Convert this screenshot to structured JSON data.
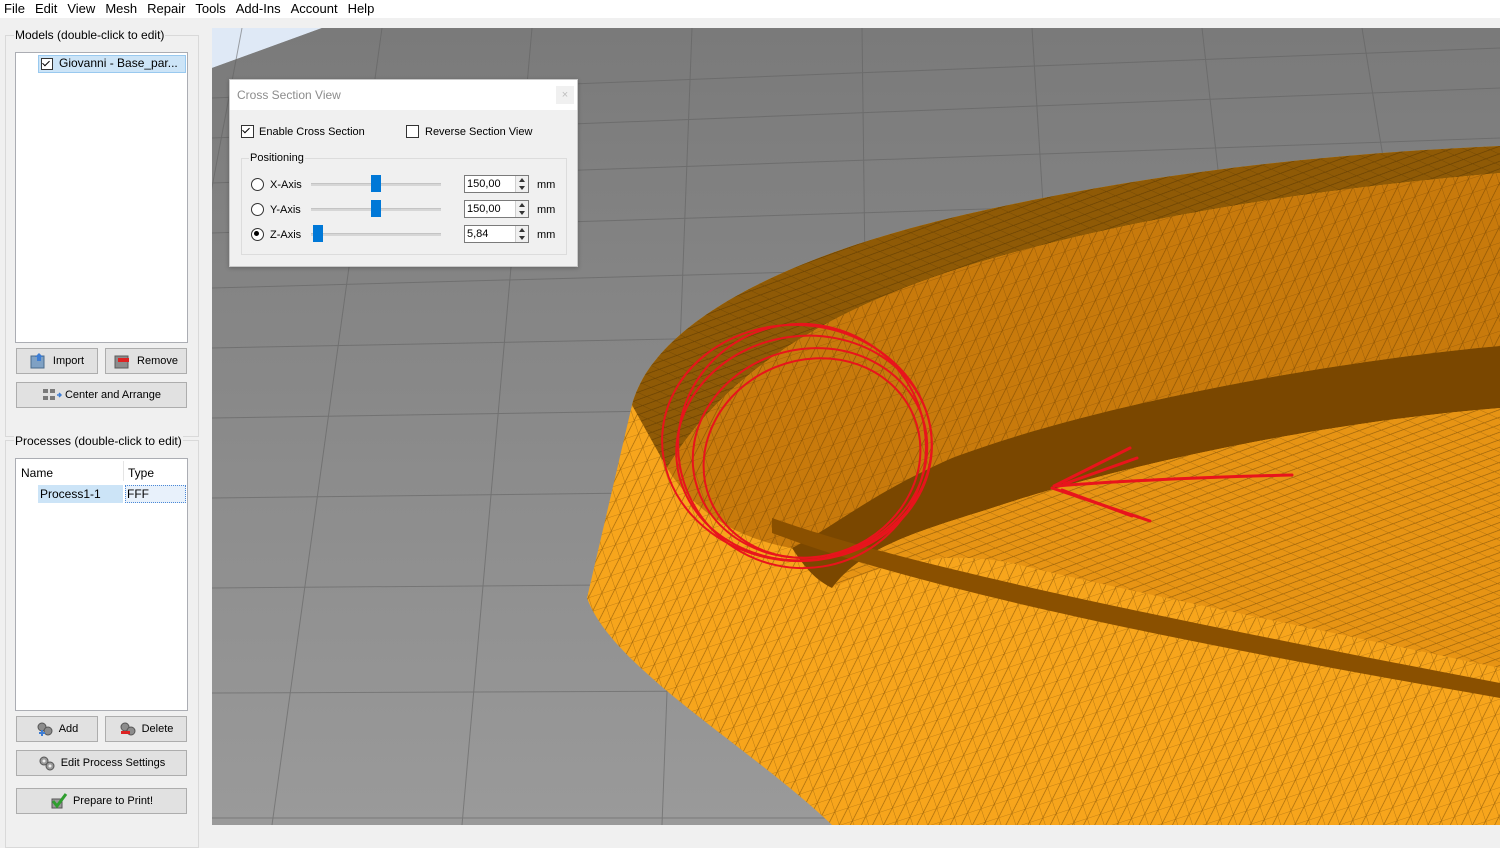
{
  "menu": [
    "File",
    "Edit",
    "View",
    "Mesh",
    "Repair",
    "Tools",
    "Add-Ins",
    "Account",
    "Help"
  ],
  "models": {
    "title": "Models (double-click to edit)",
    "items": [
      {
        "label": "Giovanni - Base_par...",
        "checked": true
      }
    ],
    "import_label": "Import",
    "remove_label": "Remove",
    "center_label": "Center and Arrange"
  },
  "processes": {
    "title": "Processes (double-click to edit)",
    "columns": [
      "Name",
      "Type"
    ],
    "rows": [
      {
        "name": "Process1-1",
        "type": "FFF"
      }
    ],
    "add_label": "Add",
    "delete_label": "Delete",
    "edit_label": "Edit Process Settings",
    "prepare_label": "Prepare to Print!"
  },
  "dialog": {
    "title": "Cross Section View",
    "close_label": "×",
    "enable_label": "Enable Cross Section",
    "enable_checked": true,
    "reverse_label": "Reverse Section View",
    "reverse_checked": false,
    "positioning_label": "Positioning",
    "axes": [
      {
        "label": "X-Axis",
        "value": "150,00",
        "unit": "mm",
        "selected": false,
        "slider": 0.5
      },
      {
        "label": "Y-Axis",
        "value": "150,00",
        "unit": "mm",
        "selected": false,
        "slider": 0.5
      },
      {
        "label": "Z-Axis",
        "value": "5,84",
        "unit": "mm",
        "selected": true,
        "slider": 0.02
      }
    ]
  },
  "colors": {
    "mesh_light": "#f7a51c",
    "mesh_dark": "#8a5000",
    "annotation": "#e8141c",
    "grid_floor": "#8a8a8a",
    "slider": "#0078d7"
  }
}
